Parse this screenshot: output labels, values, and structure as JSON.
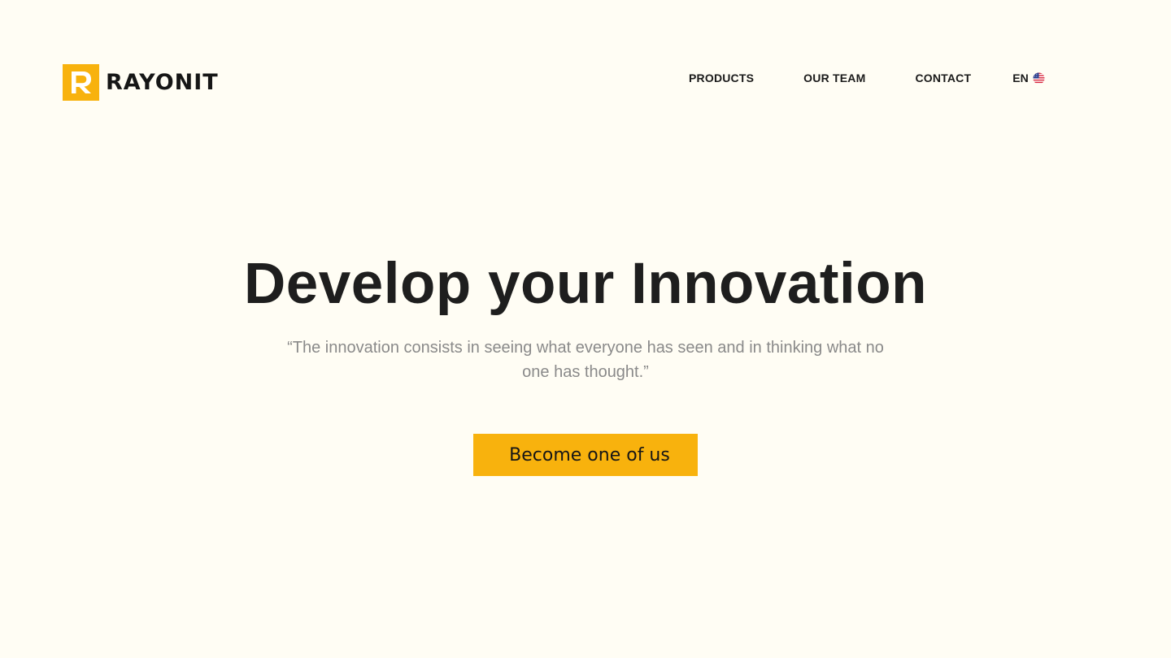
{
  "brand": {
    "name": "RAYONIT",
    "mark_letter": "R",
    "accent_color": "#F8B20D",
    "background_color": "#FFFDF4"
  },
  "nav": {
    "items": [
      {
        "label": "PRODUCTS"
      },
      {
        "label": "OUR TEAM"
      },
      {
        "label": "CONTACT"
      }
    ],
    "language": {
      "label": "EN",
      "flag_icon": "us-flag-icon"
    }
  },
  "hero": {
    "title": "Develop your Innovation",
    "quote": "“The innovation consists in seeing what everyone has seen and in thinking what no one has thought.”",
    "cta_label": "Become one of us"
  }
}
